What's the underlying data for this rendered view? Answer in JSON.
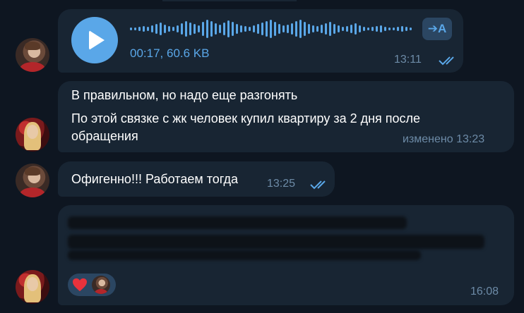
{
  "messages": [
    {
      "type": "voice",
      "duration_size": "00:17, 60.6 KB",
      "time": "13:11",
      "translate_label": "➔A",
      "icons": {
        "play": "play-icon",
        "status": "double-check-icon",
        "translate": "translate-icon"
      }
    },
    {
      "type": "text",
      "lines": [
        "В правильном, но надо еще разгонять",
        "По этой связке с жк человек купил квартиру за 2 дня после",
        "обращения"
      ],
      "meta": "изменено 13:23"
    },
    {
      "type": "text",
      "text": "Офигенно!!! Работаем тогда",
      "time": "13:25",
      "status_icon": "double-check-icon"
    },
    {
      "type": "redacted",
      "time": "16:08",
      "reaction": {
        "emoji_icon": "heart-icon",
        "user_icon": "avatar"
      }
    }
  ],
  "colors": {
    "background": "#0e1621",
    "bubble": "#182533",
    "accent": "#5aa7e8",
    "meta": "#6d8ba7",
    "reaction_bg": "#2b4662"
  }
}
